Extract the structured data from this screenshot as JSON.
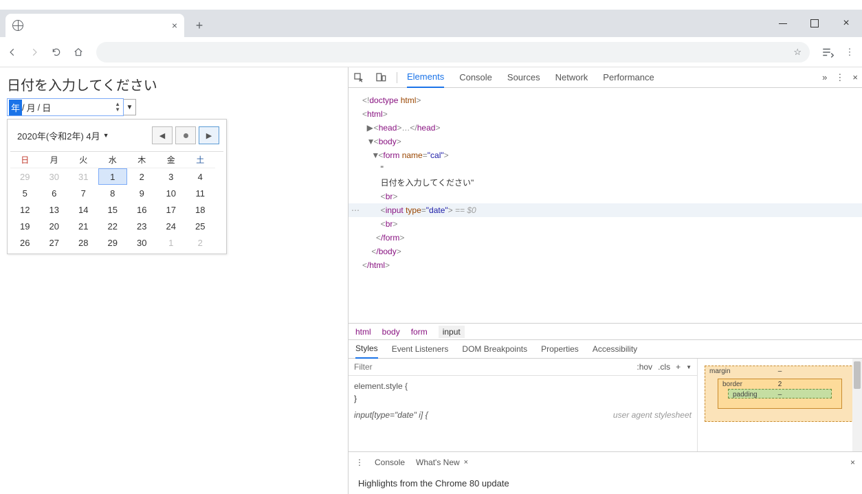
{
  "browser": {
    "tab_title": "",
    "omnibox": ""
  },
  "page": {
    "heading": "日付を入力してください",
    "date_input": {
      "year_seg": "年",
      "sep1": "/",
      "month_seg": "月",
      "sep2": "/",
      "day_seg": "日"
    },
    "calendar": {
      "title": "2020年(令和2年) 4月",
      "weekdays": [
        "日",
        "月",
        "火",
        "水",
        "木",
        "金",
        "土"
      ],
      "rows": [
        [
          {
            "d": "29",
            "other": true
          },
          {
            "d": "30",
            "other": true
          },
          {
            "d": "31",
            "other": true
          },
          {
            "d": "1",
            "sel": true
          },
          {
            "d": "2"
          },
          {
            "d": "3"
          },
          {
            "d": "4"
          }
        ],
        [
          {
            "d": "5"
          },
          {
            "d": "6"
          },
          {
            "d": "7"
          },
          {
            "d": "8"
          },
          {
            "d": "9"
          },
          {
            "d": "10"
          },
          {
            "d": "11"
          }
        ],
        [
          {
            "d": "12"
          },
          {
            "d": "13"
          },
          {
            "d": "14"
          },
          {
            "d": "15"
          },
          {
            "d": "16"
          },
          {
            "d": "17"
          },
          {
            "d": "18"
          }
        ],
        [
          {
            "d": "19"
          },
          {
            "d": "20"
          },
          {
            "d": "21"
          },
          {
            "d": "22"
          },
          {
            "d": "23"
          },
          {
            "d": "24"
          },
          {
            "d": "25"
          }
        ],
        [
          {
            "d": "26"
          },
          {
            "d": "27"
          },
          {
            "d": "28"
          },
          {
            "d": "29"
          },
          {
            "d": "30"
          },
          {
            "d": "1",
            "other": true
          },
          {
            "d": "2",
            "other": true
          }
        ]
      ]
    }
  },
  "devtools": {
    "tabs": [
      "Elements",
      "Console",
      "Sources",
      "Network",
      "Performance"
    ],
    "active_tab": "Elements",
    "dom": {
      "doctype": "<!doctype html>",
      "html_open": "html",
      "head": "head",
      "body": "body",
      "form_name": "cal",
      "text_node": "日付を入力してください\"",
      "br": "br",
      "input_type": "date",
      "eq0": "== $0",
      "form_close": "/form",
      "body_close": "/body",
      "html_close": "/html"
    },
    "breadcrumbs": [
      "html",
      "body",
      "form",
      "input"
    ],
    "style_tabs": [
      "Styles",
      "Event Listeners",
      "DOM Breakpoints",
      "Properties",
      "Accessibility"
    ],
    "filter_placeholder": "Filter",
    "filter_btns": {
      "hov": ":hov",
      "cls": ".cls",
      "plus": "+"
    },
    "css": {
      "rule1_sel": "element.style {",
      "rule1_close": "}",
      "rule2_sel": "input[type=\"date\" i] {",
      "uas": "user agent stylesheet"
    },
    "box": {
      "margin": "margin",
      "margin_top": "–",
      "border": "border",
      "border_top": "2",
      "padding": "padding",
      "padding_top": "–"
    },
    "drawer": {
      "tabs": [
        "Console",
        "What's New"
      ],
      "body": "Highlights from the Chrome 80 update"
    }
  }
}
